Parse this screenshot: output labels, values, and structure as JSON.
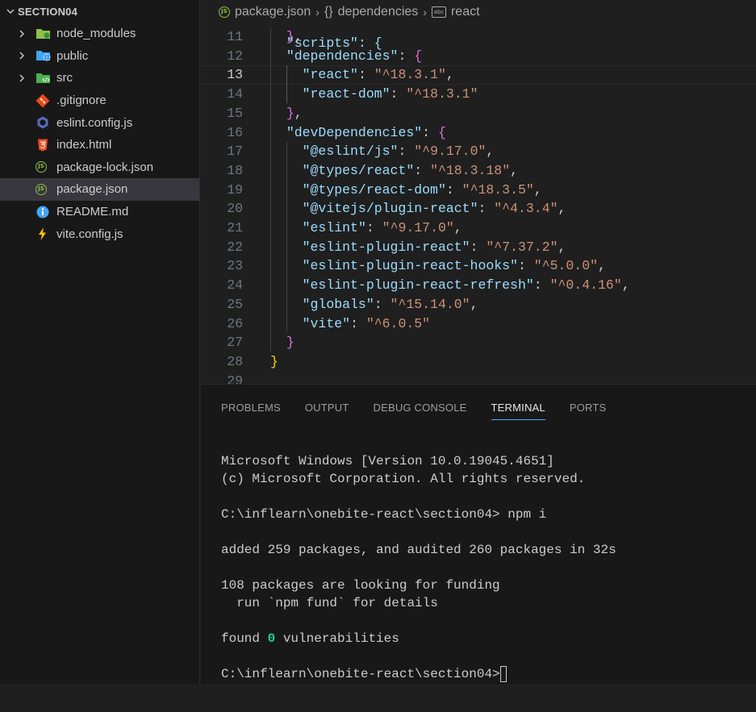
{
  "explorer": {
    "section_title": "SECTION04",
    "items": [
      {
        "label": "node_modules",
        "icon": "folder-node-icon",
        "type": "folder"
      },
      {
        "label": "public",
        "icon": "folder-public-icon",
        "type": "folder"
      },
      {
        "label": "src",
        "icon": "folder-src-icon",
        "type": "folder"
      },
      {
        "label": ".gitignore",
        "icon": "git-icon",
        "type": "file"
      },
      {
        "label": "eslint.config.js",
        "icon": "eslint-icon",
        "type": "file"
      },
      {
        "label": "index.html",
        "icon": "html5-icon",
        "type": "file"
      },
      {
        "label": "package-lock.json",
        "icon": "nodejs-icon",
        "type": "file"
      },
      {
        "label": "package.json",
        "icon": "nodejs-icon",
        "type": "file",
        "selected": true
      },
      {
        "label": "README.md",
        "icon": "info-icon",
        "type": "file"
      },
      {
        "label": "vite.config.js",
        "icon": "vite-icon",
        "type": "file"
      }
    ]
  },
  "breadcrumb": {
    "file": "package.json",
    "braces": "{}",
    "section": "dependencies",
    "symbol_icon": "abc",
    "symbol": "react"
  },
  "editor": {
    "partial_top": "\"scripts\": {",
    "lines": [
      {
        "n": "11",
        "text": "  },"
      },
      {
        "n": "12",
        "key": "dependencies",
        "text": "  \"dependencies\": {"
      },
      {
        "n": "13",
        "key": "react",
        "val": "^18.3.1"
      },
      {
        "n": "14",
        "key": "react-dom",
        "val": "^18.3.1"
      },
      {
        "n": "15",
        "text": "  },"
      },
      {
        "n": "16",
        "key": "devDependencies",
        "text": "  \"devDependencies\": {"
      },
      {
        "n": "17",
        "key": "@eslint/js",
        "val": "^9.17.0"
      },
      {
        "n": "18",
        "key": "@types/react",
        "val": "^18.3.18"
      },
      {
        "n": "19",
        "key": "@types/react-dom",
        "val": "^18.3.5"
      },
      {
        "n": "20",
        "key": "@vitejs/plugin-react",
        "val": "^4.3.4"
      },
      {
        "n": "21",
        "key": "eslint",
        "val": "^9.17.0"
      },
      {
        "n": "22",
        "key": "eslint-plugin-react",
        "val": "^7.37.2"
      },
      {
        "n": "23",
        "key": "eslint-plugin-react-hooks",
        "val": "^5.0.0"
      },
      {
        "n": "24",
        "key": "eslint-plugin-react-refresh",
        "val": "^0.4.16"
      },
      {
        "n": "25",
        "key": "globals",
        "val": "^15.14.0"
      },
      {
        "n": "26",
        "key": "vite",
        "val": "^6.0.5"
      },
      {
        "n": "27",
        "text": "  }"
      },
      {
        "n": "28",
        "text": "}"
      },
      {
        "n": "29",
        "text": ""
      }
    ],
    "active_line": "13"
  },
  "panel": {
    "tabs": [
      "PROBLEMS",
      "OUTPUT",
      "DEBUG CONSOLE",
      "TERMINAL",
      "PORTS"
    ],
    "active_tab": "TERMINAL"
  },
  "terminal": {
    "l1": "Microsoft Windows [Version 10.0.19045.4651]",
    "l2": "(c) Microsoft Corporation. All rights reserved.",
    "prompt1": "C:\\inflearn\\onebite-react\\section04> npm i",
    "added": "added 259 packages, and audited 260 packages in 32s",
    "funding1": "108 packages are looking for funding",
    "funding2": "  run `npm fund` for details",
    "found_pre": "found ",
    "found_zero": "0",
    "found_post": " vulnerabilities",
    "prompt2": "C:\\inflearn\\onebite-react\\section04>"
  }
}
